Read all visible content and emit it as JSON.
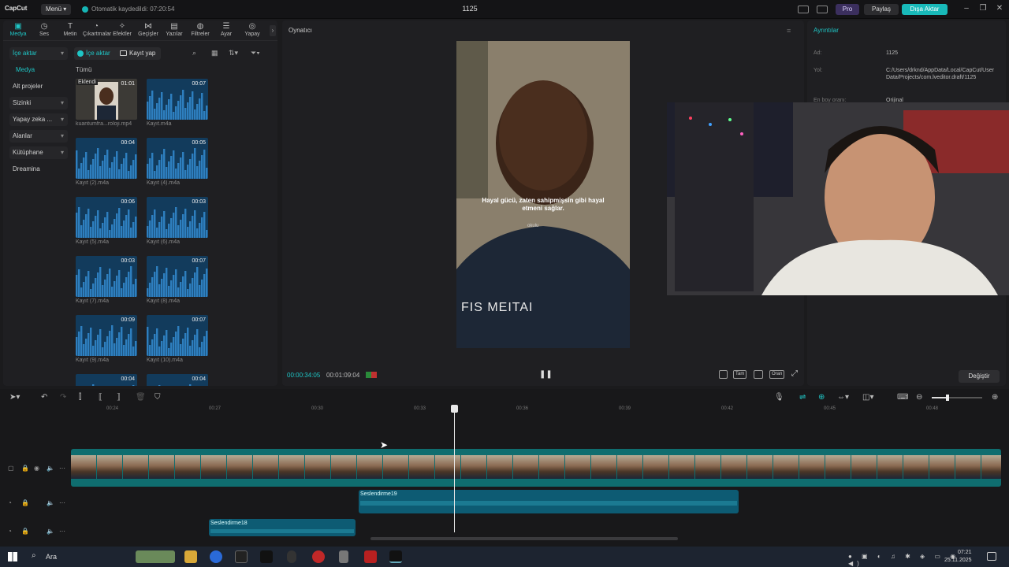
{
  "app": {
    "logo": "CapCut",
    "menu_label": "Menü",
    "autosave": "Otomatik kaydedildi: 07:20:54",
    "project_title": "1125"
  },
  "topbar": {
    "pro": "Pro",
    "share": "Paylaş",
    "export": "Dışa Aktar"
  },
  "tools": [
    {
      "label": "Medya",
      "icon": "media-icon"
    },
    {
      "label": "Ses",
      "icon": "audio-icon"
    },
    {
      "label": "Metin",
      "icon": "text-icon"
    },
    {
      "label": "Çıkartmalar",
      "icon": "sticker-icon"
    },
    {
      "label": "Efektler",
      "icon": "effects-icon"
    },
    {
      "label": "Geçişler",
      "icon": "transition-icon"
    },
    {
      "label": "Yazılar",
      "icon": "captions-icon"
    },
    {
      "label": "Filtreler",
      "icon": "filter-icon"
    },
    {
      "label": "Ayar",
      "icon": "adjust-icon"
    },
    {
      "label": "Yapay",
      "icon": "ai-icon"
    }
  ],
  "categories": [
    {
      "label": "İçe aktar",
      "has_chevron": true
    },
    {
      "label": "Medya",
      "has_chevron": false
    },
    {
      "label": "Alt projeler",
      "has_chevron": false
    },
    {
      "label": "Sizinki",
      "has_chevron": true
    },
    {
      "label": "Yapay zeka ...",
      "has_chevron": true
    },
    {
      "label": "Alanlar",
      "has_chevron": true
    },
    {
      "label": "Kütüphane",
      "has_chevron": true
    },
    {
      "label": "Dreamina",
      "has_chevron": false
    }
  ],
  "media_tabs": {
    "import": "İçe aktar",
    "record": "Kayıt yap"
  },
  "all_label": "Tümü",
  "media_items": [
    {
      "name": "kuantumfra...roloji.mp4",
      "duration": "01:01",
      "badge": "Eklendi",
      "kind": "video"
    },
    {
      "name": "Kayıt.m4a",
      "duration": "00:07",
      "kind": "audio"
    },
    {
      "name": "Kayıt (2).m4a",
      "duration": "00:04",
      "kind": "audio"
    },
    {
      "name": "Kayıt (4).m4a",
      "duration": "00:05",
      "kind": "audio"
    },
    {
      "name": "Kayıt (5).m4a",
      "duration": "00:06",
      "kind": "audio"
    },
    {
      "name": "Kayıt (6).m4a",
      "duration": "00:03",
      "kind": "audio"
    },
    {
      "name": "Kayıt (7).m4a",
      "duration": "00:03",
      "kind": "audio"
    },
    {
      "name": "Kayıt (8).m4a",
      "duration": "00:07",
      "kind": "audio"
    },
    {
      "name": "Kayıt (9).m4a",
      "duration": "00:09",
      "kind": "audio"
    },
    {
      "name": "Kayıt (10).m4a",
      "duration": "00:07",
      "kind": "audio"
    },
    {
      "name": "",
      "duration": "00:04",
      "kind": "audio"
    },
    {
      "name": "",
      "duration": "00:04",
      "kind": "audio"
    }
  ],
  "player": {
    "title": "Oynatıcı",
    "subtitle": "Hayal gücü, zaten sahipmişsin gibi hayal etmeni sağlar.",
    "watermark": "okulu",
    "hoodie_text": "FIS MEITAI",
    "time_current": "00:00:34:05",
    "time_total": "00:01:09:04",
    "ctl_full": "Tam",
    "ctl_orig": "Oran"
  },
  "details": {
    "title": "Ayrıntılar",
    "name_label": "Ad:",
    "name_value": "1125",
    "path_label": "Yol:",
    "path_value": "C:/Users/drknd/AppData/Local/CapCut/User Data/Projects/com.lveditor.draft/1125",
    "ratio_label": "En boy oranı:",
    "ratio_value": "Orijinal",
    "change_button": "Değiştir"
  },
  "timeline": {
    "ruler": [
      "00:24",
      "00:27",
      "00:30",
      "00:33",
      "00:36",
      "00:39",
      "00:42",
      "00:45",
      "00:48"
    ],
    "audio_clip_1": "Seslendirme19",
    "audio_clip_2": "Seslendirme18",
    "playhead_fraction": 0.408
  },
  "taskbar": {
    "search": "Ara",
    "time": "07:21",
    "date": "25.11.2025"
  },
  "colors": {
    "accent": "#1fc6c6",
    "export": "#18b9b9",
    "video_track": "#0f6d6f",
    "audio_track": "#0d5b73"
  }
}
